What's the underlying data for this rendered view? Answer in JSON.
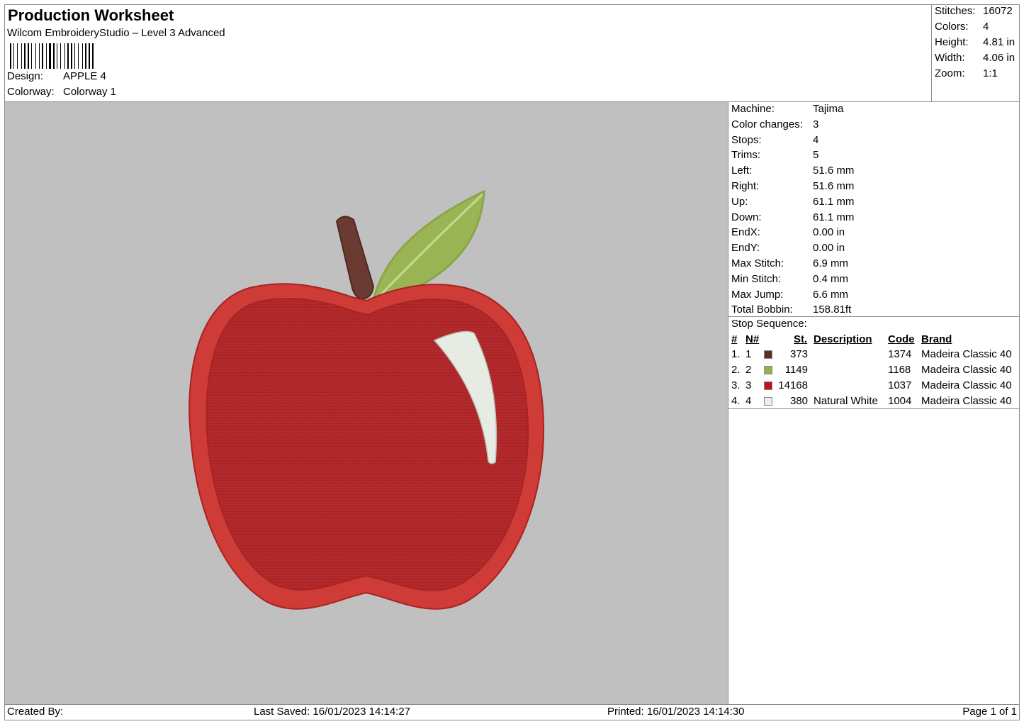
{
  "header": {
    "title": "Production Worksheet",
    "subtitle": "Wilcom EmbroideryStudio – Level 3 Advanced",
    "design_label": "Design:",
    "design_value": "APPLE 4",
    "colorway_label": "Colorway:",
    "colorway_value": "Colorway 1"
  },
  "stats": {
    "stitches_label": "Stitches:",
    "stitches_value": "16072",
    "colors_label": "Colors:",
    "colors_value": "4",
    "height_label": "Height:",
    "height_value": "4.81 in",
    "width_label": "Width:",
    "width_value": "4.06 in",
    "zoom_label": "Zoom:",
    "zoom_value": "1:1"
  },
  "machine_info": [
    {
      "label": "Machine:",
      "value": "Tajima"
    },
    {
      "label": "Color changes:",
      "value": "3"
    },
    {
      "label": "Stops:",
      "value": "4"
    },
    {
      "label": "Trims:",
      "value": "5"
    },
    {
      "label": "Left:",
      "value": "51.6 mm"
    },
    {
      "label": "Right:",
      "value": "51.6 mm"
    },
    {
      "label": "Up:",
      "value": "61.1 mm"
    },
    {
      "label": "Down:",
      "value": "61.1 mm"
    },
    {
      "label": "EndX:",
      "value": "0.00 in"
    },
    {
      "label": "EndY:",
      "value": "0.00 in"
    },
    {
      "label": "Max Stitch:",
      "value": "6.9 mm"
    },
    {
      "label": "Min Stitch:",
      "value": "0.4 mm"
    },
    {
      "label": "Max Jump:",
      "value": "6.6 mm"
    },
    {
      "label": "Total Bobbin:",
      "value": "158.81ft"
    }
  ],
  "stop_sequence": {
    "title": "Stop Sequence:",
    "headers": {
      "num": "#",
      "n": "N#",
      "st": "St.",
      "description": "Description",
      "code": "Code",
      "brand": "Brand"
    },
    "rows": [
      {
        "num": "1.",
        "n": "1",
        "color": "#5a2e2c",
        "st": "373",
        "description": "",
        "code": "1374",
        "brand": "Madeira Classic 40"
      },
      {
        "num": "2.",
        "n": "2",
        "color": "#9aae4c",
        "st": "1149",
        "description": "",
        "code": "1168",
        "brand": "Madeira Classic 40"
      },
      {
        "num": "3.",
        "n": "3",
        "color": "#c0121c",
        "st": "14168",
        "description": "",
        "code": "1037",
        "brand": "Madeira Classic 40"
      },
      {
        "num": "4.",
        "n": "4",
        "color": "#eeeeef",
        "st": "380",
        "description": "Natural White",
        "code": "1004",
        "brand": "Madeira Classic 40"
      }
    ]
  },
  "footer": {
    "created_by": "Created By:",
    "last_saved": "Last Saved: 16/01/2023 14:14:27",
    "printed": "Printed: 16/01/2023 14:14:30",
    "page": "Page 1 of 1"
  },
  "colors": {
    "preview_background": "#c0c0c0",
    "apple_red": "#b8282a",
    "apple_outline": "#cc3a36",
    "stem": "#6e3b30",
    "leaf": "#9ab754",
    "highlight": "#e8ece6"
  },
  "icons": [
    "barcode-icon",
    "apple-embroidery-image"
  ]
}
